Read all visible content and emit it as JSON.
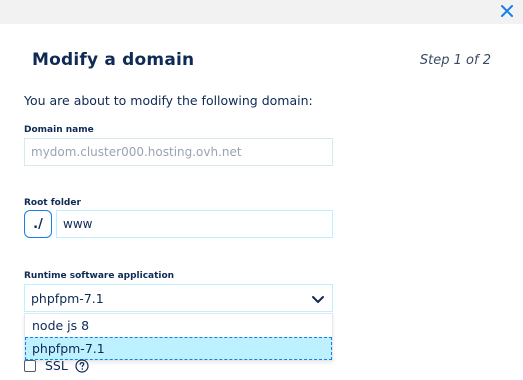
{
  "header": {
    "close_icon": "close-icon"
  },
  "dialog": {
    "title": "Modify a domain",
    "step": "Step 1 of 2",
    "intro": "You are about to modify the following domain:"
  },
  "domain_name": {
    "label": "Domain name",
    "value": "mydom.cluster000.hosting.ovh.net"
  },
  "root_folder": {
    "label": "Root folder",
    "prefix": "./",
    "value": "www"
  },
  "runtime": {
    "label": "Runtime software application",
    "selected": "phpfpm-7.1",
    "options": [
      {
        "label": "node js 8"
      },
      {
        "label": "phpfpm-7.1"
      }
    ]
  },
  "ssl": {
    "label": "SSL",
    "checked": false,
    "help_icon": "question-circle-icon"
  },
  "colors": {
    "accent": "#157eea",
    "field_border": "#bef1ff",
    "text_dark": "#0e2a55"
  }
}
